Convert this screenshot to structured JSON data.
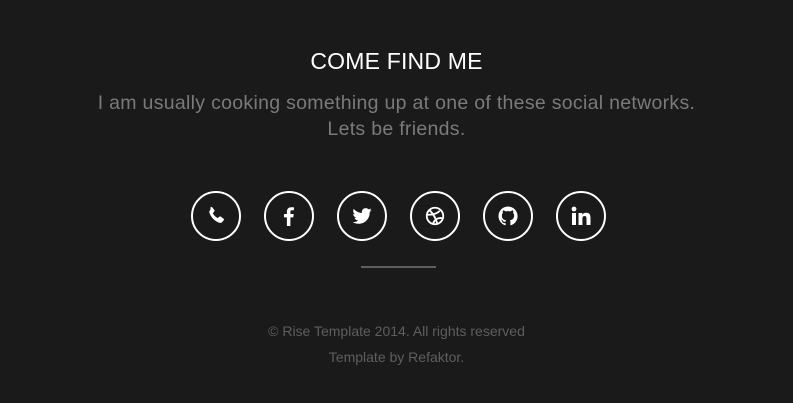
{
  "section": {
    "title": "COME FIND ME",
    "subtitle": "I am usually cooking something up at one of these social networks. Lets be friends."
  },
  "social_links": [
    {
      "icon": "phone-icon"
    },
    {
      "icon": "facebook-icon"
    },
    {
      "icon": "twitter-icon"
    },
    {
      "icon": "dribbble-icon"
    },
    {
      "icon": "github-icon"
    },
    {
      "icon": "linkedin-icon"
    }
  ],
  "footer": {
    "copyright": "© Rise Template 2014. All rights reserved",
    "credit_prefix": "Template by ",
    "credit_link": "Refaktor",
    "credit_suffix": "."
  },
  "colors": {
    "background": "#1b1a1b",
    "title": "#ffffff",
    "subtitle": "#7a7a7a",
    "icon_border": "#ffffff",
    "divider": "#5f5f5f",
    "footer_text": "#5e5e5e"
  }
}
